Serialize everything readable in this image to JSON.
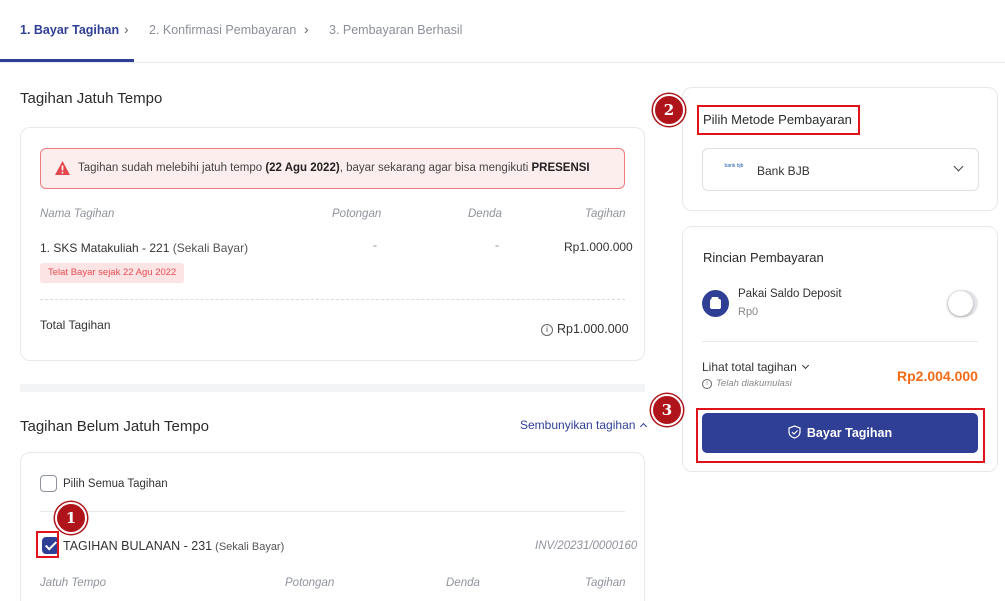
{
  "breadcrumb": {
    "step1": "1. Bayar Tagihan",
    "step2": "2. Konfirmasi Pembayaran",
    "step3": "3. Pembayaran Berhasil"
  },
  "overdue": {
    "title": "Tagihan Jatuh Tempo",
    "alert": {
      "prefix": "Tagihan sudah melebihi jatuh tempo ",
      "date": "(22 Agu 2022)",
      "middle": ", bayar sekarang agar bisa mengikuti ",
      "highlight": "PRESENSI",
      "icon": "warning-icon"
    },
    "headers": {
      "name": "Nama Tagihan",
      "discount": "Potongan",
      "fine": "Denda",
      "bill": "Tagihan"
    },
    "item": {
      "name": "1. SKS Matakuliah - 221",
      "type": " (Sekali Bayar)",
      "discount": "-",
      "fine": "-",
      "amount": "Rp1.000.000",
      "badge": "Telat Bayar sejak 22 Agu 2022"
    },
    "total_label": "Total Tagihan",
    "total_value": "Rp1.000.000"
  },
  "upcoming": {
    "title": "Tagihan Belum Jatuh Tempo",
    "hide_link": "Sembunyikan tagihan",
    "select_all": "Pilih Semua Tagihan",
    "item": {
      "name": "TAGIHAN BULANAN - 231",
      "type": " (Sekali Bayar)",
      "invoice": "INV/20231/0000160",
      "checked": true
    },
    "headers": {
      "due": "Jatuh Tempo",
      "discount": "Potongan",
      "fine": "Denda",
      "bill": "Tagihan"
    }
  },
  "payment_method": {
    "title": "Pilih Metode Pembayaran",
    "selected": "Bank BJB",
    "logo_text": "bank bjb"
  },
  "details": {
    "title": "Rincian Pembayaran",
    "deposit_label": "Pakai Saldo Deposit",
    "deposit_value": "Rp0",
    "deposit_enabled": false,
    "total_label": "Lihat total tagihan",
    "total_note": "Telah diakumulasi",
    "total_value": "Rp2.004.000",
    "pay_button": "Bayar Tagihan"
  },
  "annotations": [
    "1",
    "2",
    "3"
  ],
  "colors": {
    "primary": "#2f3f95",
    "alert_border": "#ef7b7e",
    "total_orange": "#f36b16",
    "annotation_red": "#e0121b"
  }
}
